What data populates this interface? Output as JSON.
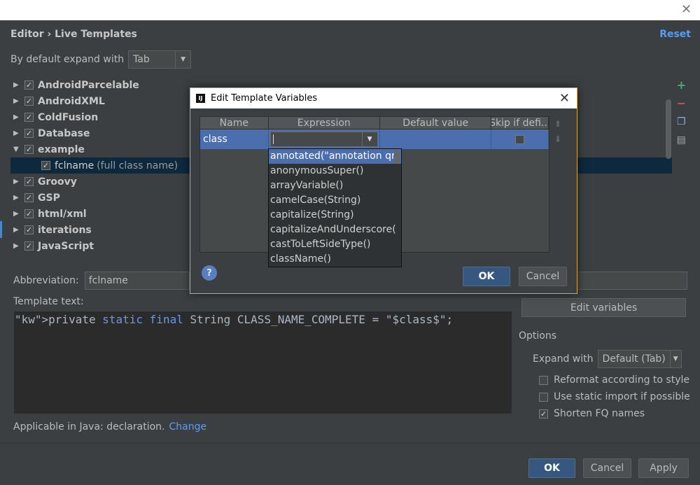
{
  "window": {
    "close_glyph": "✕"
  },
  "header": {
    "breadcrumb": "Editor › Live Templates",
    "reset": "Reset"
  },
  "expand_default": {
    "label": "By default expand with",
    "value": "Tab"
  },
  "tree": [
    {
      "label": "AndroidParcelable",
      "expanded": false
    },
    {
      "label": "AndroidXML",
      "expanded": false
    },
    {
      "label": "ColdFusion",
      "expanded": false
    },
    {
      "label": "Database",
      "expanded": false
    },
    {
      "label": "example",
      "expanded": true
    },
    {
      "label": "fclname",
      "desc": "(full class name)",
      "child": true
    },
    {
      "label": "Groovy",
      "expanded": false
    },
    {
      "label": "GSP",
      "expanded": false
    },
    {
      "label": "html/xml",
      "expanded": false
    },
    {
      "label": "iterations",
      "expanded": false
    },
    {
      "label": "JavaScript",
      "expanded": false
    }
  ],
  "abbreviation": {
    "label": "Abbreviation:",
    "value": "fclname"
  },
  "template_text": {
    "label": "Template text:",
    "code": "private static final String CLASS_NAME_COMPLETE = \"$class$\";"
  },
  "edit_variables": "Edit variables",
  "options": {
    "title": "Options",
    "expand_label": "Expand with",
    "expand_value": "Default (Tab)",
    "reformat": "Reformat according to style",
    "static_import": "Use static import if possible",
    "shorten_fq": "Shorten FQ names"
  },
  "applicable": {
    "text": "Applicable in Java: declaration.",
    "link": "Change"
  },
  "footer": {
    "ok": "OK",
    "cancel": "Cancel",
    "apply": "Apply"
  },
  "modal": {
    "title": "Edit Template Variables",
    "columns": [
      "Name",
      "Expression",
      "Default value",
      "Skip if defi..."
    ],
    "row": {
      "name": "class",
      "expression": "",
      "default": ""
    },
    "ok": "OK",
    "cancel": "Cancel",
    "help": "?"
  },
  "suggestions": [
    "annotated(\"annotation qr",
    "anonymousSuper()",
    "arrayVariable()",
    "camelCase(String)",
    "capitalize(String)",
    "capitalizeAndUnderscore(",
    "castToLeftSideType()",
    "className()"
  ]
}
